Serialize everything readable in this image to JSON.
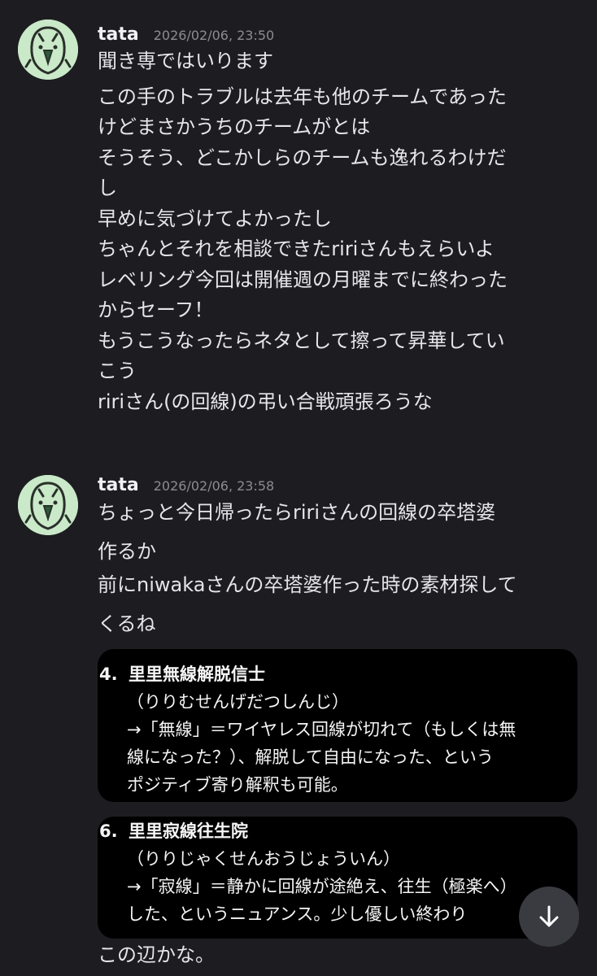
{
  "messages": [
    {
      "author": "tata",
      "timestamp": "2026/02/06, 23:50",
      "lines": [
        "聞き専ではいります",
        "この手のトラブルは去年も他のチームであった",
        "けどまさかうちのチームがとは",
        "そうそう、どこかしらのチームも逸れるわけだ",
        "し",
        "早めに気づけてよかったし",
        "ちゃんとそれを相談できたririさんもえらいよ",
        "レベリング今回は開催週の月曜までに終わった",
        "からセーフ！",
        "もうこうなったらネタとして擦って昇華してい",
        "こう",
        "ririさん(の回線)の弔い合戦頑張ろうな"
      ]
    },
    {
      "author": "tata",
      "timestamp": "2026/02/06, 23:58",
      "lines": [
        "ちょっと今日帰ったらririさんの回線の卒塔婆",
        "作るか",
        "前にniwakaさんの卒塔婆作った時の素材探して",
        "くるね"
      ],
      "attachments": [
        {
          "number": "4.",
          "title": "里里無線解脱信士",
          "reading": "（りりむせんげだつしんじ）",
          "description": [
            "→「無線」＝ワイヤレス回線が切れて（もしくは無",
            "線になった？）、解脱して自由になった、という",
            "ポジティブ寄り解釈も可能。"
          ]
        },
        {
          "number": "6.",
          "title": "里里寂線往生院",
          "reading": "（りりじゃくせんおうじょういん）",
          "description": [
            "→「寂線」＝静かに回線が途絶え、往生（極楽へ）",
            "した、というニュアンス。少し優しい終わり"
          ]
        }
      ],
      "trailing_text": "この辺かな。"
    }
  ],
  "icons": {
    "avatar": "parrot-avatar-icon",
    "scroll": "arrow-down-icon"
  },
  "colors": {
    "background": "#1d1d21",
    "avatar_bg": "#c9e9c9",
    "card_bg": "#000000",
    "scroll_button": "#3a3b41"
  }
}
